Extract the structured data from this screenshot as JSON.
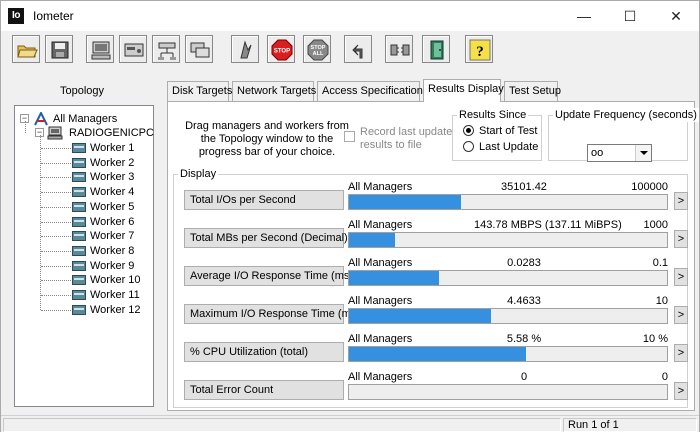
{
  "window": {
    "title": "Iometer",
    "icon_text": "Io"
  },
  "window_controls": {
    "minimize": "—",
    "maximize": "☐",
    "close": "✕"
  },
  "toolbar": {
    "buttons": [
      {
        "icon": "open-folder-icon"
      },
      {
        "icon": "save-disk-icon"
      },
      {
        "icon": "computer-icon"
      },
      {
        "icon": "disk-worker-icon"
      },
      {
        "icon": "network-worker-icon"
      },
      {
        "icon": "duplicate-worker-icon"
      },
      {
        "icon": "start-flag-icon"
      },
      {
        "icon": "stop-icon",
        "label": "STOP"
      },
      {
        "icon": "stop-all-icon",
        "label": "STOP",
        "label2": "ALL"
      },
      {
        "icon": "reset-arrow-icon"
      },
      {
        "icon": "disconnect-icon"
      },
      {
        "icon": "exit-door-icon"
      },
      {
        "icon": "help-icon",
        "label": "?"
      }
    ]
  },
  "topology": {
    "header": "Topology",
    "root": "All Managers",
    "manager": "RADIOGENICPC",
    "workers": [
      "Worker 1",
      "Worker 2",
      "Worker 3",
      "Worker 4",
      "Worker 5",
      "Worker 6",
      "Worker 7",
      "Worker 8",
      "Worker 9",
      "Worker 10",
      "Worker 11",
      "Worker 12"
    ]
  },
  "tabs": [
    "Disk Targets",
    "Network Targets",
    "Access Specifications",
    "Results Display",
    "Test Setup"
  ],
  "results": {
    "drag_text": "Drag managers and workers from the Topology window to the progress bar of your choice.",
    "record_label": "Record last update results to file",
    "results_since": {
      "title": "Results Since",
      "options": [
        "Start of Test",
        "Last Update"
      ],
      "selected": "Start of Test"
    },
    "update_frequency": {
      "title": "Update Frequency (seconds)",
      "value": "oo"
    },
    "display_title": "Display",
    "metrics": [
      {
        "label": "Total I/Os per Second",
        "source": "All Managers",
        "value": "35101.42",
        "max": "100000",
        "fill": 0.351
      },
      {
        "label": "Total MBs per Second (Decimal)",
        "source": "All Managers",
        "value": "143.78 MBPS (137.11 MiBPS)",
        "max": "1000",
        "fill": 0.144
      },
      {
        "label": "Average I/O Response Time (ms)",
        "source": "All Managers",
        "value": "0.0283",
        "max": "0.1",
        "fill": 0.283
      },
      {
        "label": "Maximum I/O Response Time (ms)",
        "source": "All Managers",
        "value": "4.4633",
        "max": "10",
        "fill": 0.446
      },
      {
        "label": "% CPU Utilization (total)",
        "source": "All Managers",
        "value": "5.58 %",
        "max": "10 %",
        "fill": 0.558
      },
      {
        "label": "Total Error Count",
        "source": "All Managers",
        "value": "0",
        "max": "0",
        "fill": 0
      }
    ],
    "more_label": ">"
  },
  "status": {
    "run": "Run 1 of 1"
  },
  "colors": {
    "bar": "#3590e0"
  }
}
